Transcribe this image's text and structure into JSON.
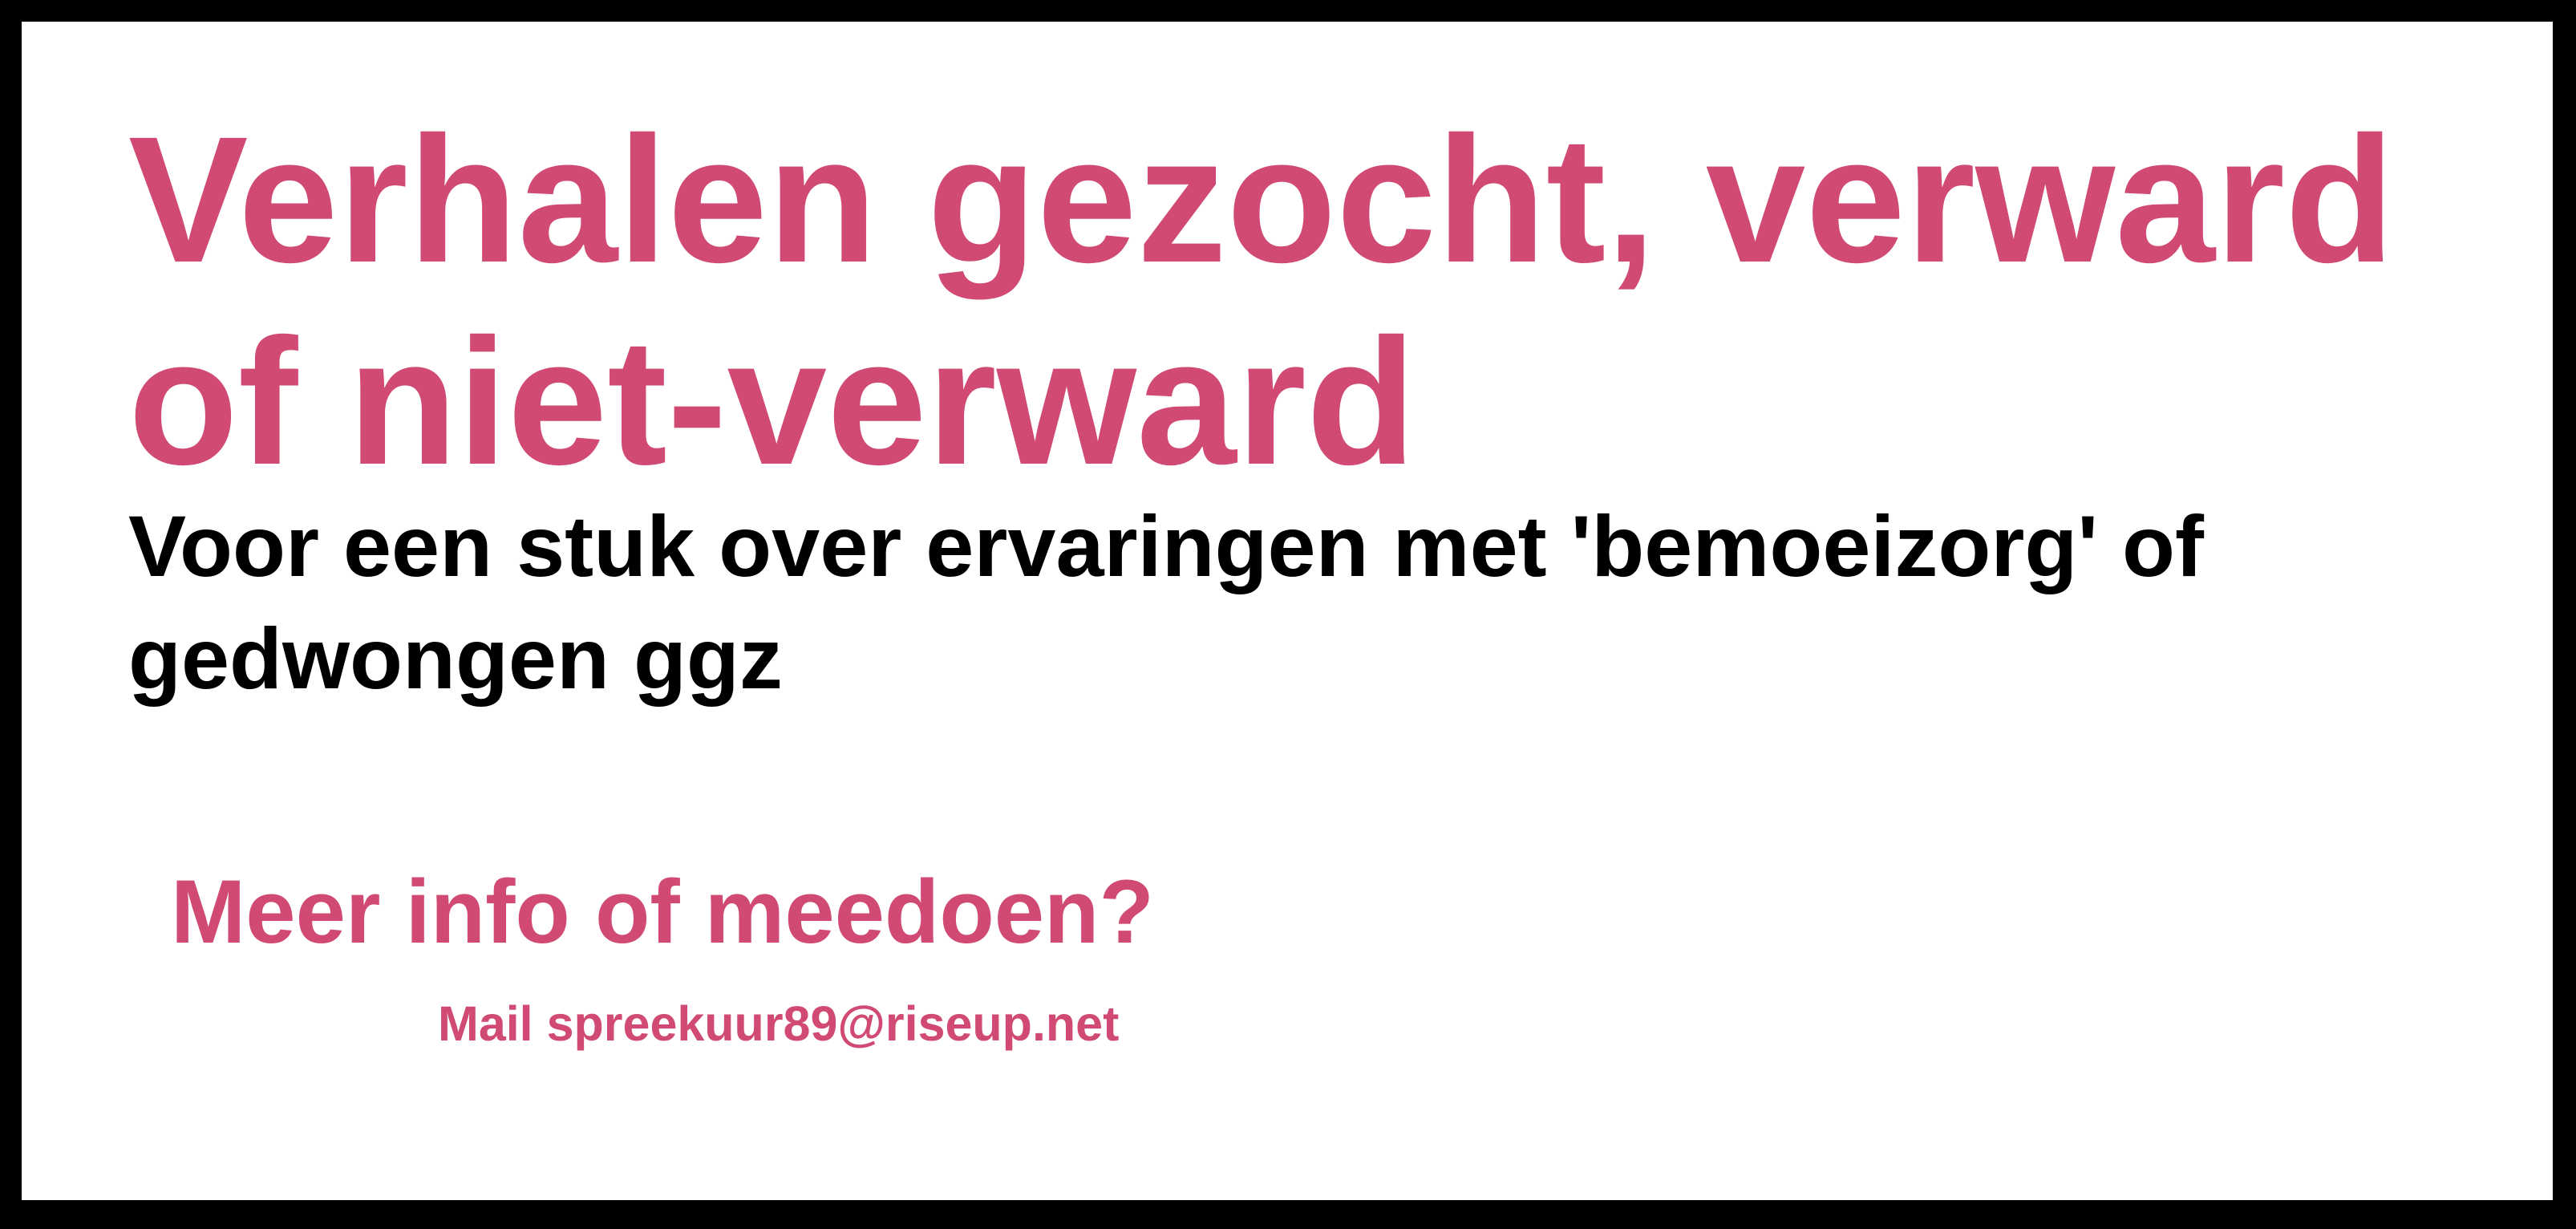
{
  "poster": {
    "title": "Verhalen gezocht, verward of niet-verward",
    "subtitle": "Voor een stuk over ervaringen met 'bemoeizorg' of gedwongen ggz",
    "cta": "Meer info of meedoen?",
    "mail_prefix": "Mail",
    "email": "spreekuur89@riseup.net"
  },
  "colors": {
    "accent": "#d04a73",
    "text": "#000000",
    "background": "#ffffff",
    "border": "#000000"
  }
}
